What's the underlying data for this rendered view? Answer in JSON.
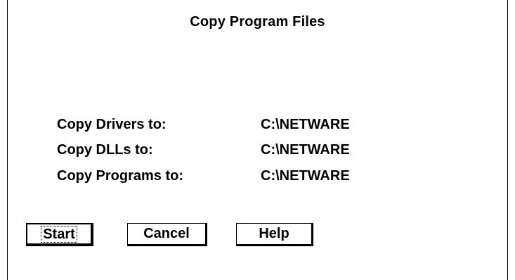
{
  "dialog": {
    "title": "Copy Program Files",
    "rows": [
      {
        "label": "Copy Drivers to:",
        "value": "C:\\NETWARE"
      },
      {
        "label": "Copy DLLs to:",
        "value": "C:\\NETWARE"
      },
      {
        "label": "Copy Programs to:",
        "value": "C:\\NETWARE"
      }
    ],
    "buttons": {
      "start": "Start",
      "cancel": "Cancel",
      "help": "Help"
    }
  }
}
